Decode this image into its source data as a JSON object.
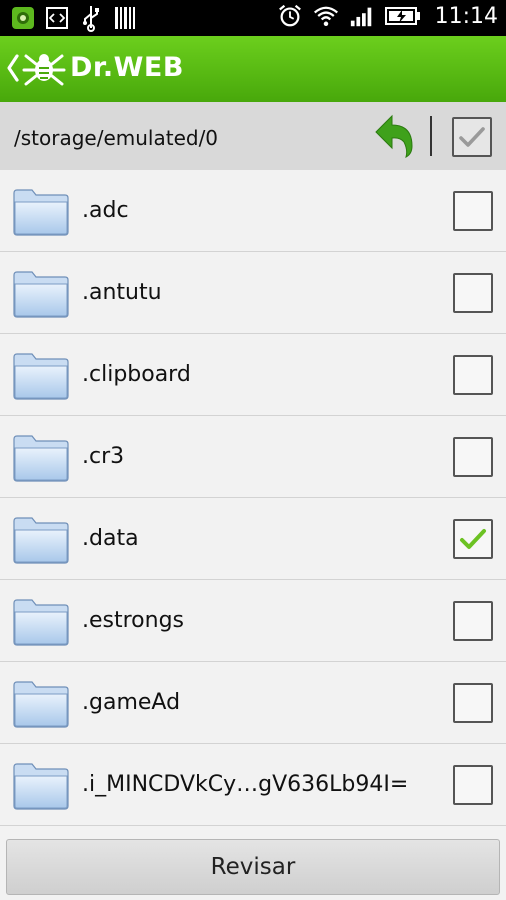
{
  "status_bar": {
    "time": "11:14",
    "left_icons": [
      "drweb-notification-icon",
      "code-icon",
      "usb-icon",
      "barcode-icon"
    ],
    "right_icons": [
      "alarm-icon",
      "wifi-icon",
      "signal-icon",
      "battery-charging-icon"
    ]
  },
  "app": {
    "title": "Dr.WEB",
    "accent_color": "#56b714"
  },
  "path_bar": {
    "path": "/storage/emulated/0",
    "up_icon": "back-arrow-icon",
    "select_all_checked": true
  },
  "folders": [
    {
      "name": ".adc",
      "checked": false
    },
    {
      "name": ".antutu",
      "checked": false
    },
    {
      "name": ".clipboard",
      "checked": false
    },
    {
      "name": ".cr3",
      "checked": false
    },
    {
      "name": ".data",
      "checked": true
    },
    {
      "name": ".estrongs",
      "checked": false
    },
    {
      "name": ".gameAd",
      "checked": false
    },
    {
      "name": ".i_MINCDVkCy…gV636Lb94I=",
      "checked": false
    }
  ],
  "footer": {
    "button_label": "Revisar"
  }
}
